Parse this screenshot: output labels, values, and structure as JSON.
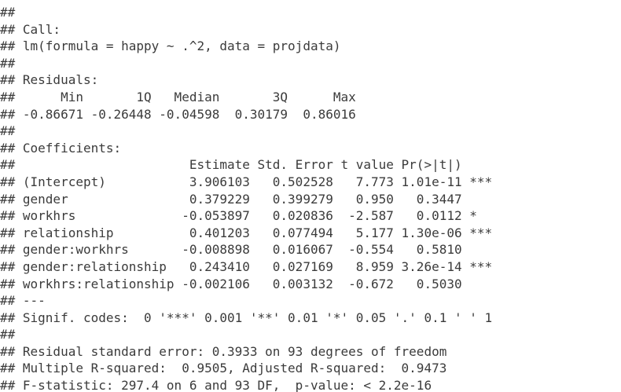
{
  "console": {
    "lines": [
      "##",
      "## Call:",
      "## lm(formula = happy ~ .^2, data = projdata)",
      "##",
      "## Residuals:",
      "##      Min       1Q   Median       3Q      Max",
      "## -0.86671 -0.26448 -0.04598  0.30179  0.86016",
      "##",
      "## Coefficients:",
      "##                       Estimate Std. Error t value Pr(>|t|)",
      "## (Intercept)           3.906103   0.502528   7.773 1.01e-11 ***",
      "## gender                0.379229   0.399279   0.950   0.3447",
      "## workhrs              -0.053897   0.020836  -2.587   0.0112 *",
      "## relationship          0.401203   0.077494   5.177 1.30e-06 ***",
      "## gender:workhrs       -0.008898   0.016067  -0.554   0.5810",
      "## gender:relationship   0.243410   0.027169   8.959 3.26e-14 ***",
      "## workhrs:relationship -0.002106   0.003132  -0.672   0.5030",
      "## ---",
      "## Signif. codes:  0 '***' 0.001 '**' 0.01 '*' 0.05 '.' 0.1 ' ' 1",
      "##",
      "## Residual standard error: 0.3933 on 93 degrees of freedom",
      "## Multiple R-squared:  0.9505, Adjusted R-squared:  0.9473",
      "## F-statistic: 297.4 on 6 and 93 DF,  p-value: < 2.2e-16"
    ]
  }
}
